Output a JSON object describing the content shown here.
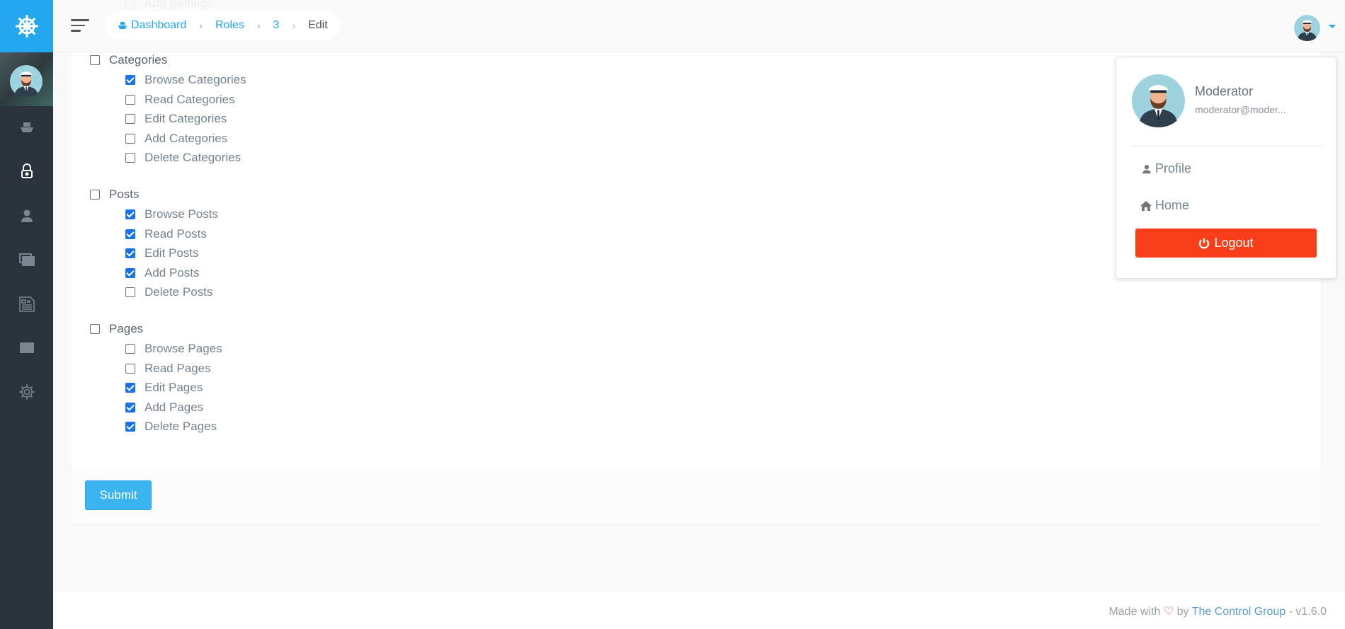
{
  "breadcrumb": {
    "items": [
      "Dashboard",
      "Roles",
      "3"
    ],
    "current": "Edit"
  },
  "permissions": {
    "partial_top": {
      "label": "Add Settings",
      "checked": false
    },
    "groups": [
      {
        "label": "Categories",
        "checked": false,
        "items": [
          {
            "label": "Browse Categories",
            "checked": true
          },
          {
            "label": "Read Categories",
            "checked": false
          },
          {
            "label": "Edit Categories",
            "checked": false
          },
          {
            "label": "Add Categories",
            "checked": false
          },
          {
            "label": "Delete Categories",
            "checked": false
          }
        ]
      },
      {
        "label": "Posts",
        "checked": false,
        "items": [
          {
            "label": "Browse Posts",
            "checked": true
          },
          {
            "label": "Read Posts",
            "checked": true
          },
          {
            "label": "Edit Posts",
            "checked": true
          },
          {
            "label": "Add Posts",
            "checked": true
          },
          {
            "label": "Delete Posts",
            "checked": false
          }
        ]
      },
      {
        "label": "Pages",
        "checked": false,
        "items": [
          {
            "label": "Browse Pages",
            "checked": false
          },
          {
            "label": "Read Pages",
            "checked": false
          },
          {
            "label": "Edit Pages",
            "checked": true
          },
          {
            "label": "Add Pages",
            "checked": true
          },
          {
            "label": "Delete Pages",
            "checked": true
          }
        ]
      }
    ]
  },
  "submit_label": "Submit",
  "user_menu": {
    "name": "Moderator",
    "email": "moderator@moder...",
    "profile": "Profile",
    "home": "Home",
    "logout": "Logout"
  },
  "sidebar": {
    "icons": [
      "boat-icon",
      "lock-icon",
      "user-icon",
      "images-icon",
      "news-icon",
      "folder-icon",
      "gear-icon"
    ],
    "active": "lock-icon"
  },
  "footer": {
    "made_with": "Made with",
    "by": "by",
    "company": "The Control Group",
    "version": "- v1.6.0"
  },
  "colors": {
    "accent": "#22a7f0",
    "sidebar": "#2a323c",
    "logout": "#fa3e19",
    "checkbox": "#1a73e8"
  }
}
